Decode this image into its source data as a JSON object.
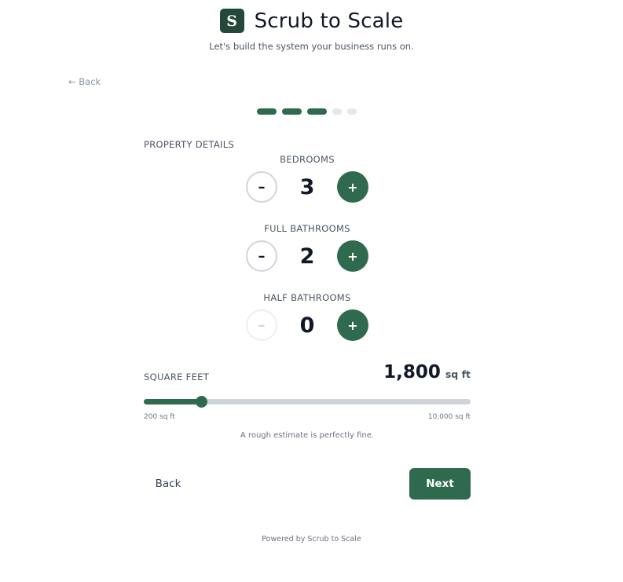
{
  "header": {
    "logo_letter": "S",
    "app_title": "Scrub to Scale",
    "subtitle": "Let's build the system your business runs on."
  },
  "nav": {
    "back_link": "← Back"
  },
  "progress": {
    "total_steps": 5,
    "completed_steps": 3
  },
  "property": {
    "section_title": "PROPERTY DETAILS",
    "steppers": [
      {
        "label": "BEDROOMS",
        "value": "3",
        "minus_label": "–",
        "plus_label": "+",
        "minus_disabled": false
      },
      {
        "label": "FULL BATHROOMS",
        "value": "2",
        "minus_label": "–",
        "plus_label": "+",
        "minus_disabled": false
      },
      {
        "label": "HALF BATHROOMS",
        "value": "0",
        "minus_label": "–",
        "plus_label": "+",
        "minus_disabled": true
      }
    ]
  },
  "square_feet": {
    "label": "SQUARE FEET",
    "value": "1,800",
    "value_number": 1800,
    "unit": "sq ft",
    "min_number": 200,
    "max_number": 10000,
    "min_label": "200 sq ft",
    "max_label": "10,000 sq ft",
    "hint": "A rough estimate is perfectly fine."
  },
  "footer": {
    "back_label": "Back",
    "next_label": "Next",
    "powered_by": "Powered by Scrub to Scale"
  },
  "colors": {
    "brand": "#2f6a4f",
    "logo_bg": "#24493a",
    "track": "#d1d5db",
    "text": "#111827",
    "muted": "#6b7280"
  }
}
